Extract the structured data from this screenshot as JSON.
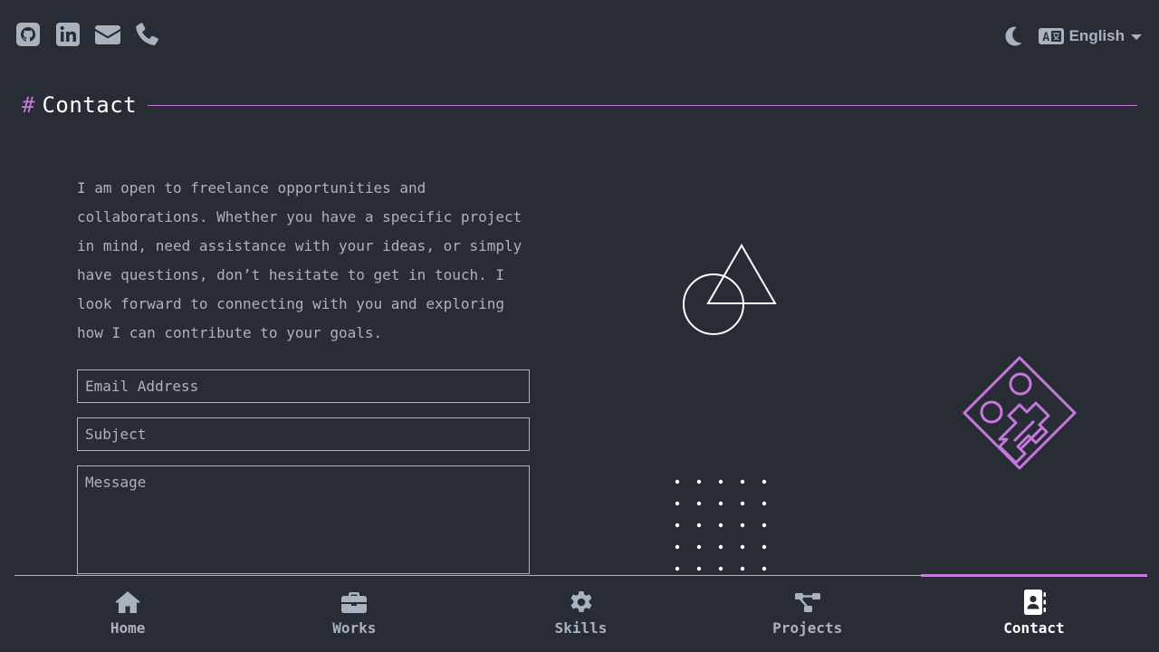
{
  "header": {
    "social": [
      {
        "icon": "github-icon"
      },
      {
        "icon": "linkedin-icon"
      },
      {
        "icon": "envelope-icon"
      },
      {
        "icon": "phone-icon"
      }
    ],
    "theme_icon": "moon-icon",
    "language_icon": "translate-icon",
    "language": "English"
  },
  "section": {
    "hash": "#",
    "title": "Contact"
  },
  "intro": "I am open to freelance opportunities and collaborations. Whether you have a specific project in mind, need assistance with your ideas, or simply have questions, don’t hesitate to get in touch. I look forward to connecting with you and exploring how I can contribute to your goals.",
  "form": {
    "email_placeholder": "Email Address",
    "email_value": "",
    "subject_placeholder": "Subject",
    "subject_value": "",
    "message_placeholder": "Message",
    "message_value": ""
  },
  "nav": {
    "items": [
      {
        "label": "Home",
        "icon": "house-icon"
      },
      {
        "label": "Works",
        "icon": "briefcase-icon"
      },
      {
        "label": "Skills",
        "icon": "gear-icon"
      },
      {
        "label": "Projects",
        "icon": "diagram-icon"
      },
      {
        "label": "Contact",
        "icon": "address-book-icon"
      }
    ],
    "active": "Contact"
  },
  "colors": {
    "background": "#282c34",
    "text": "#abb2bf",
    "accent": "#c678dd",
    "heading": "#ffffff"
  }
}
